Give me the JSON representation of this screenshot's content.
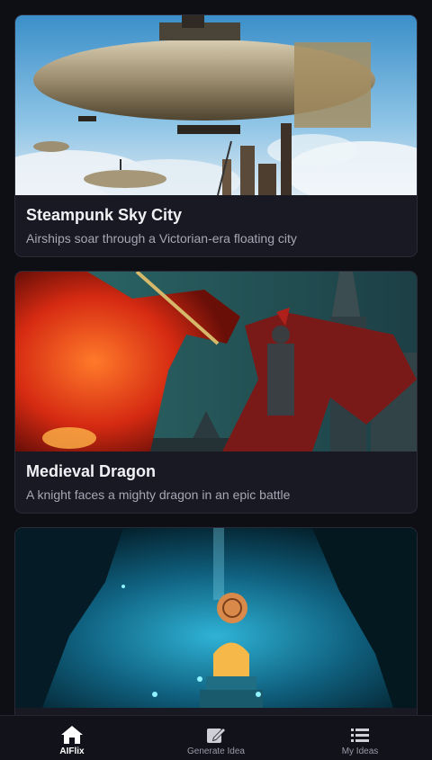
{
  "cards": [
    {
      "title": "Steampunk Sky City",
      "description": "Airships soar through a Victorian-era floating city",
      "image_icon": "airship-image"
    },
    {
      "title": "Medieval Dragon",
      "description": "A knight faces a mighty dragon in an epic battle",
      "image_icon": "dragon-knight-image"
    },
    {
      "title": "",
      "description": "",
      "image_icon": "underwater-cave-image"
    }
  ],
  "nav": {
    "items": [
      {
        "label": "AIFlix",
        "icon": "home-icon",
        "active": true
      },
      {
        "label": "Generate Idea",
        "icon": "edit-icon",
        "active": false
      },
      {
        "label": "My Ideas",
        "icon": "list-icon",
        "active": false
      }
    ]
  },
  "colors": {
    "background": "#0e0e15",
    "card": "#191924",
    "nav": "#12121a"
  }
}
